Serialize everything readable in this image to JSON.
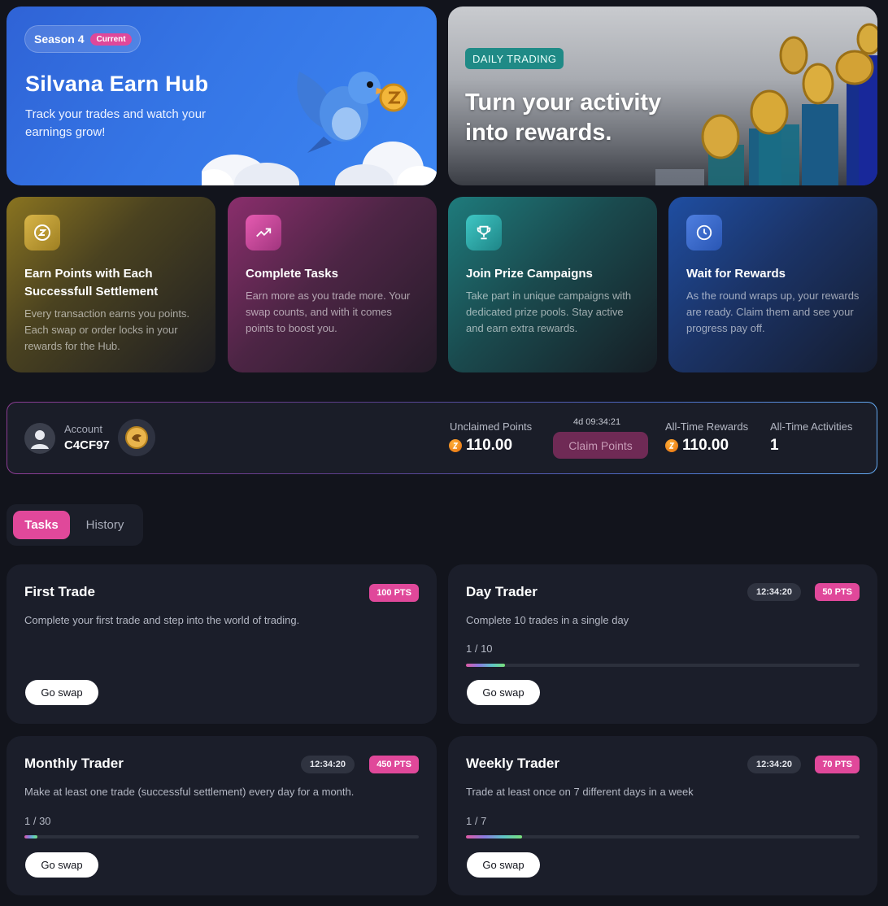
{
  "hero": {
    "season_label": "Season 4",
    "current_badge": "Current",
    "title": "Silvana Earn Hub",
    "subtitle": "Track your trades and watch your earnings grow!",
    "daily_tag": "DAILY TRADING",
    "daily_title": "Turn your activity into rewards."
  },
  "steps": [
    {
      "icon": "lightning-coin-icon",
      "title": "Earn Points with Each Successfull Settlement",
      "text": "Every transaction earns you points. Each swap or order locks in your rewards for the Hub."
    },
    {
      "icon": "trending-up-icon",
      "title": "Complete Tasks",
      "text": "Earn more as you trade more. Your swap counts, and with it comes points to boost you."
    },
    {
      "icon": "trophy-icon",
      "title": "Join Prize Campaigns",
      "text": "Take part in unique campaigns with dedicated prize pools. Stay active and earn extra rewards."
    },
    {
      "icon": "clock-icon",
      "title": "Wait for Rewards",
      "text": "As the round wraps up, your rewards are ready. Claim them and see your progress pay off."
    }
  ],
  "account": {
    "label": "Account",
    "id": "C4CF97",
    "unclaimed_label": "Unclaimed Points",
    "unclaimed_value": "110.00",
    "timer": "4d 09:34:21",
    "claim_label": "Claim Points",
    "alltime_rewards_label": "All-Time Rewards",
    "alltime_rewards_value": "110.00",
    "alltime_activities_label": "All-Time Activities",
    "alltime_activities_value": "1"
  },
  "tabs": {
    "tasks": "Tasks",
    "history": "History"
  },
  "tasks": [
    {
      "title": "First Trade",
      "points": "100 PTS",
      "timer": "",
      "description": "Complete your first trade and step into the world of trading.",
      "progress_text": "",
      "progress": 0,
      "button": "Go swap"
    },
    {
      "title": "Day Trader",
      "points": "50 PTS",
      "timer": "12:34:20",
      "description": "Complete 10 trades in a single day",
      "progress_text": "1 / 10",
      "progress": 0.1,
      "button": "Go swap"
    },
    {
      "title": "Monthly Trader",
      "points": "450 PTS",
      "timer": "12:34:20",
      "description": "Make at least one trade (successful settlement) every day for a month.",
      "progress_text": "1 / 30",
      "progress": 0.0333,
      "button": "Go swap"
    },
    {
      "title": "Weekly Trader",
      "points": "70 PTS",
      "timer": "12:34:20",
      "description": "Trade at least once on 7 different days in a week",
      "progress_text": "1 / 7",
      "progress": 0.1429,
      "button": "Go swap"
    }
  ],
  "colors": {
    "accent_pink": "#e0489a",
    "background": "#12141c",
    "card": "#1b1e2a",
    "hero_blue": "#3576e6",
    "daily_teal": "#1f8a86"
  }
}
